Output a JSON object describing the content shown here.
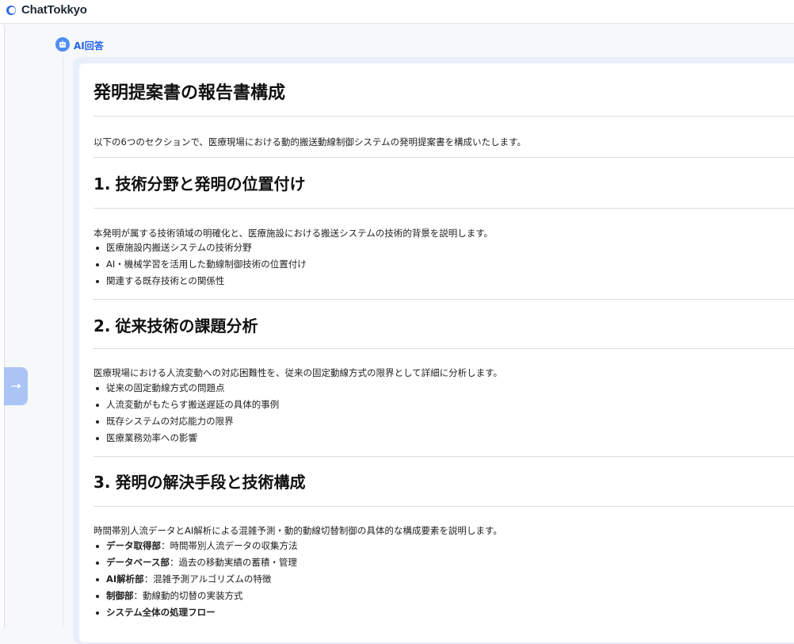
{
  "app": {
    "brand": "ChatTokkyo"
  },
  "sidebar": {
    "expand_icon": "arrow-right-icon"
  },
  "message": {
    "role_label": "AI回答",
    "role_icon": "robot-icon"
  },
  "doc": {
    "title": "発明提案書の報告書構成",
    "intro": "以下の6つのセクションで、医療現場における動的搬送動線制御システムの発明提案書を構成いたします。",
    "sections": [
      {
        "num": "1.",
        "heading": "技術分野と発明の位置付け",
        "desc": "本発明が属する技術領域の明確化と、医療施設における搬送システムの技術的背景を説明します。",
        "bullets": [
          "医療施設内搬送システムの技術分野",
          "AI・機械学習を活用した動線制御技術の位置付け",
          "関連する既存技術との関係性"
        ]
      },
      {
        "num": "2.",
        "heading": "従来技術の課題分析",
        "desc": "医療現場における人流変動への対応困難性を、従来の固定動線方式の限界として詳細に分析します。",
        "bullets": [
          "従来の固定動線方式の問題点",
          "人流変動がもたらす搬送遅延の具体的事例",
          "既存システムの対応能力の限界",
          "医療業務効率への影響"
        ]
      },
      {
        "num": "3.",
        "heading": "発明の解決手段と技術構成",
        "desc": "時間帯別人流データとAI解析による混雑予測・動的動線切替制御の具体的な構成要素を説明します。",
        "bullets": [
          {
            "bold": "データ取得部",
            "text": "：時間帯別人流データの収集方法"
          },
          {
            "bold": "データベース部",
            "text": "：過去の移動実績の蓄積・管理"
          },
          {
            "bold": "AI解析部",
            "text": "：混雑予測アルゴリズムの特徴"
          },
          {
            "bold": "制御部",
            "text": "：動線動的切替の実装方式"
          },
          {
            "bold": "システム全体の処理フロー",
            "text": ""
          }
        ]
      }
    ]
  },
  "colors": {
    "accent": "#2563eb",
    "card_border": "#e8eefc",
    "expand_button": "#a9c4f5"
  }
}
